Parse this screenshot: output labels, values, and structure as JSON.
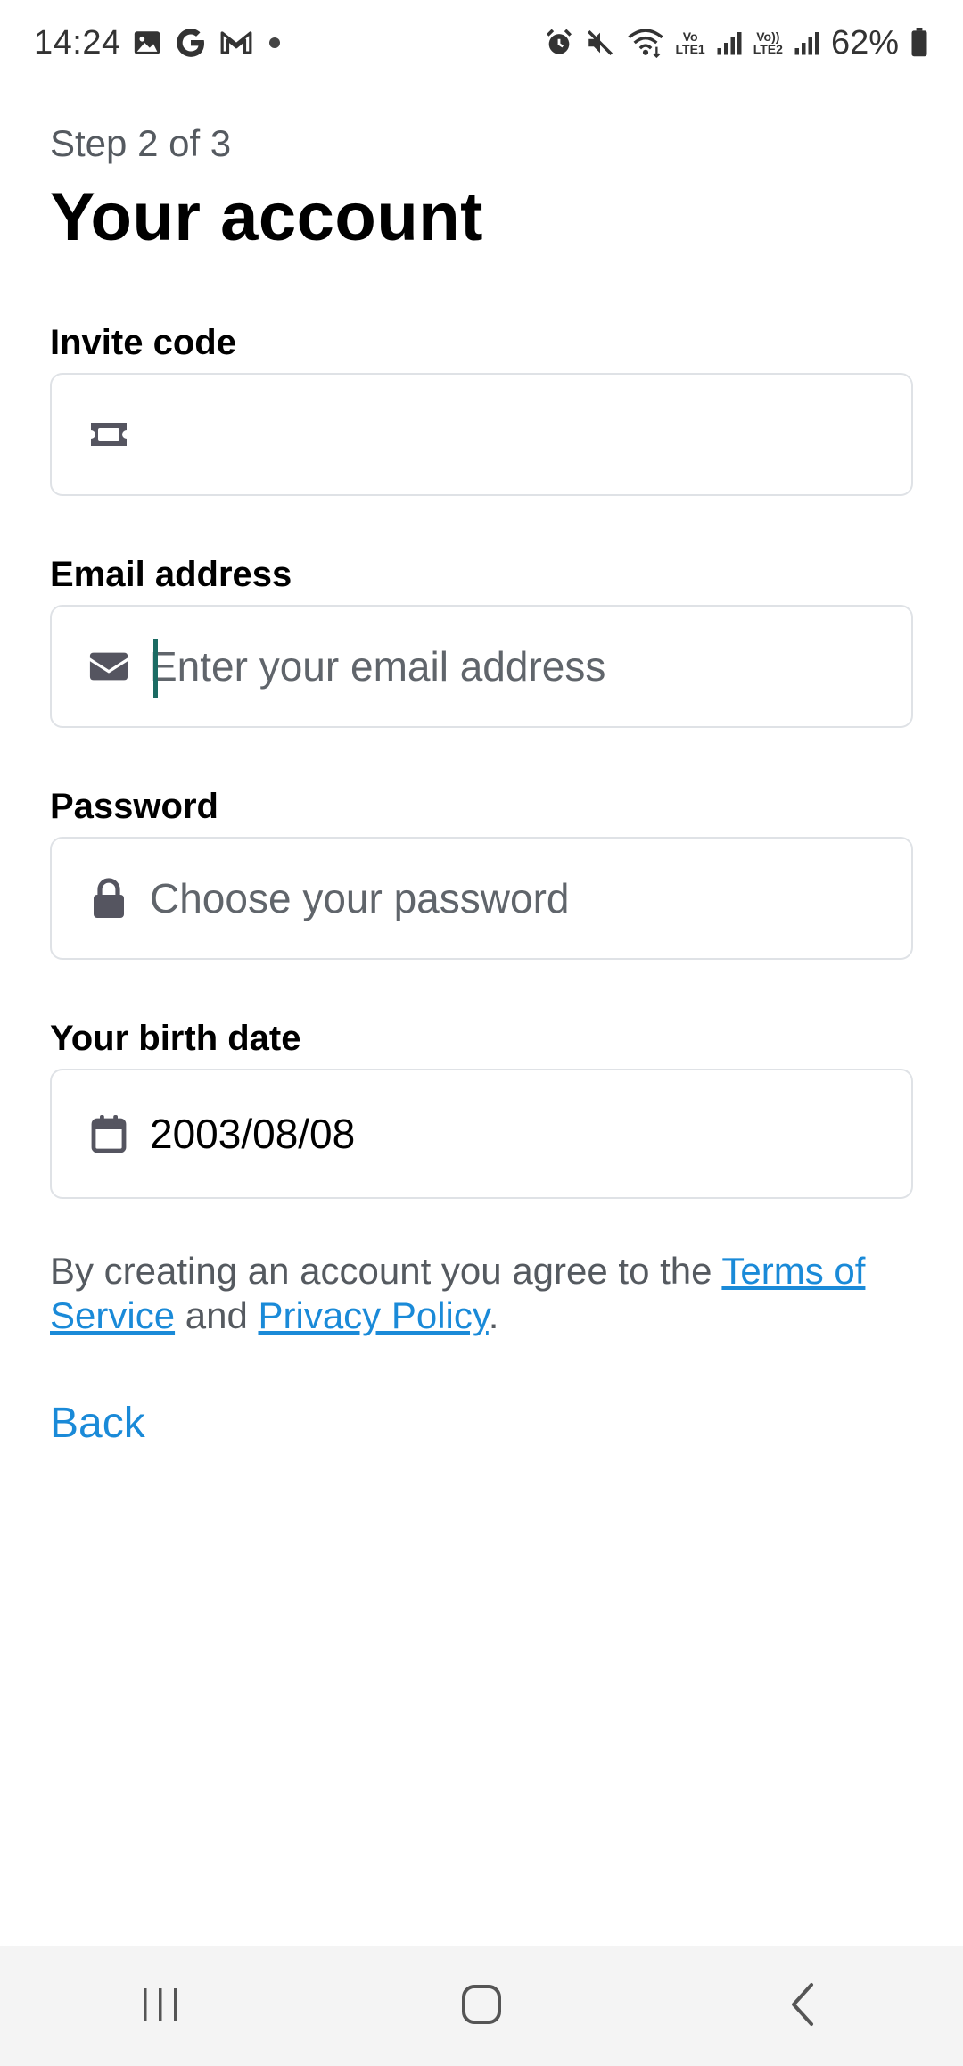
{
  "status_bar": {
    "time": "14:24",
    "battery": "62%",
    "sim1_label_top": "Vo",
    "sim1_label_bottom": "LTE1",
    "sim2_label_top": "Vo))",
    "sim2_label_bottom": "LTE2",
    "icons_left": [
      "gallery-icon",
      "google-icon",
      "gmail-icon",
      "notification-dot-icon"
    ],
    "icons_right": [
      "alarm-icon",
      "mute-icon",
      "wifi-icon",
      "signal-icon",
      "battery-icon"
    ]
  },
  "header": {
    "step": "Step 2 of 3",
    "title": "Your account"
  },
  "form": {
    "invite_code": {
      "label": "Invite code",
      "value": "",
      "placeholder": "",
      "icon": "ticket-icon"
    },
    "email": {
      "label": "Email address",
      "value": "",
      "placeholder": "Enter your email address",
      "icon": "envelope-icon"
    },
    "password": {
      "label": "Password",
      "value": "",
      "placeholder": "Choose your password",
      "icon": "lock-icon"
    },
    "birth_date": {
      "label": "Your birth date",
      "value": "2003/08/08",
      "icon": "calendar-icon"
    }
  },
  "terms": {
    "prefix": "By creating an account you agree to the ",
    "tos_link": "Terms of Service",
    "middle": " and ",
    "privacy_link": "Privacy Policy",
    "suffix": "."
  },
  "actions": {
    "back": "Back"
  },
  "colors": {
    "link": "#1a8ad8",
    "caret": "#1b6b63",
    "icon": "#555560",
    "border": "#dfe2e6"
  },
  "nav_bar": {
    "buttons": [
      "recent-apps-icon",
      "home-icon",
      "back-icon"
    ]
  }
}
